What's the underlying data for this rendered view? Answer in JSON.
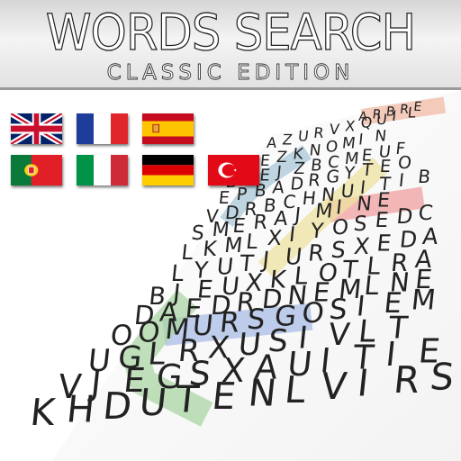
{
  "header": {
    "title": "WORDS SEARCH",
    "subtitle": "CLASSIC EDITION"
  },
  "languages": [
    {
      "name": "uk-flag"
    },
    {
      "name": "france-flag"
    },
    {
      "name": "spain-flag"
    },
    {
      "name": "portugal-flag"
    },
    {
      "name": "italy-flag"
    },
    {
      "name": "germany-flag"
    },
    {
      "name": "turkey-flag"
    }
  ],
  "grid": {
    "rows": [
      "ARBRE",
      "AZURVXQUIL",
      "DEZKNOMIN",
      "DAEJZBCMEUF",
      "EPBADRGYTEO",
      "VDRBCHNUITIB",
      "SMERAJMINE",
      "LKMLXIYOSEDC",
      "LYUTJURSXEDA",
      "BJEUXKLOTLRA",
      "DAEDRDNEMLNE",
      "OOMURSGOSIEM",
      "UGLRXUSIVLT",
      "VJEGSXAUITIE",
      "KHDUTENLVIRS"
    ]
  },
  "highlights": [
    {
      "word": "ARBRE",
      "color": "#f2b9a5"
    },
    {
      "word": "MINE",
      "color": "#f0a0a0"
    },
    {
      "word": "OURS",
      "color": "#a9bde6"
    },
    {
      "word": "diagonal-yellow",
      "color": "#ede1a0"
    },
    {
      "word": "diagonal-green",
      "color": "#a9d6a3"
    },
    {
      "word": "diagonal-blue",
      "color": "#aac8d8"
    }
  ]
}
